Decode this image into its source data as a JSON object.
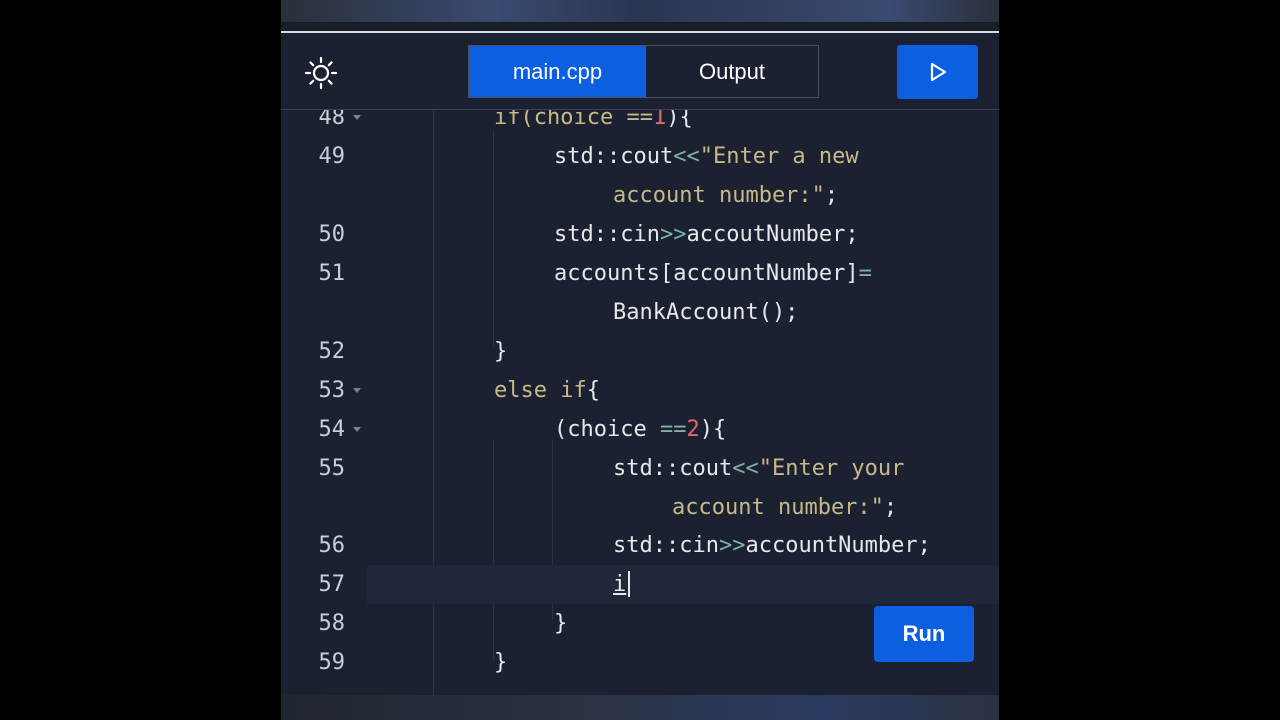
{
  "header": {
    "theme_icon": "sun-icon",
    "tabs": [
      {
        "label": "main.cpp",
        "active": true
      },
      {
        "label": "Output",
        "active": false
      }
    ],
    "play_icon": "play-icon"
  },
  "colors": {
    "accent": "#0b5fe0",
    "background": "#1b2130",
    "string": "#c8b989",
    "operator": "#7fb3a8",
    "number": "#e06a6a",
    "line_number": "#c9ced8"
  },
  "editor": {
    "lines": [
      {
        "num": "48",
        "fold": true,
        "parts": [
          "if(choice ==",
          "1",
          "){"
        ]
      },
      {
        "num": "49",
        "fold": false,
        "parts": [
          "std::cout",
          "<<",
          "\"Enter a new"
        ]
      },
      {
        "num": "",
        "fold": false,
        "parts": [
          "account number:\"",
          ";"
        ]
      },
      {
        "num": "50",
        "fold": false,
        "parts": [
          "std::cin",
          ">>",
          "accoutNumber;"
        ]
      },
      {
        "num": "51",
        "fold": false,
        "parts": [
          "accounts[accountNumber]",
          "="
        ]
      },
      {
        "num": "",
        "fold": false,
        "parts": [
          "BankAccount();"
        ]
      },
      {
        "num": "52",
        "fold": false,
        "parts": [
          "}"
        ]
      },
      {
        "num": "53",
        "fold": true,
        "parts": [
          "else if",
          "{"
        ]
      },
      {
        "num": "54",
        "fold": true,
        "parts": [
          "(choice ",
          "==",
          "2",
          "){"
        ]
      },
      {
        "num": "55",
        "fold": false,
        "parts": [
          "std::cout",
          "<<",
          "\"Enter your"
        ]
      },
      {
        "num": "",
        "fold": false,
        "parts": [
          "account number:\"",
          ";"
        ]
      },
      {
        "num": "56",
        "fold": false,
        "parts": [
          "std::cin",
          ">>",
          "accountNumber;"
        ]
      },
      {
        "num": "57",
        "fold": false,
        "parts": [
          "i"
        ]
      },
      {
        "num": "58",
        "fold": false,
        "parts": [
          "}"
        ]
      },
      {
        "num": "59",
        "fold": false,
        "parts": [
          "}"
        ]
      }
    ]
  },
  "run_button": {
    "label": "Run"
  }
}
